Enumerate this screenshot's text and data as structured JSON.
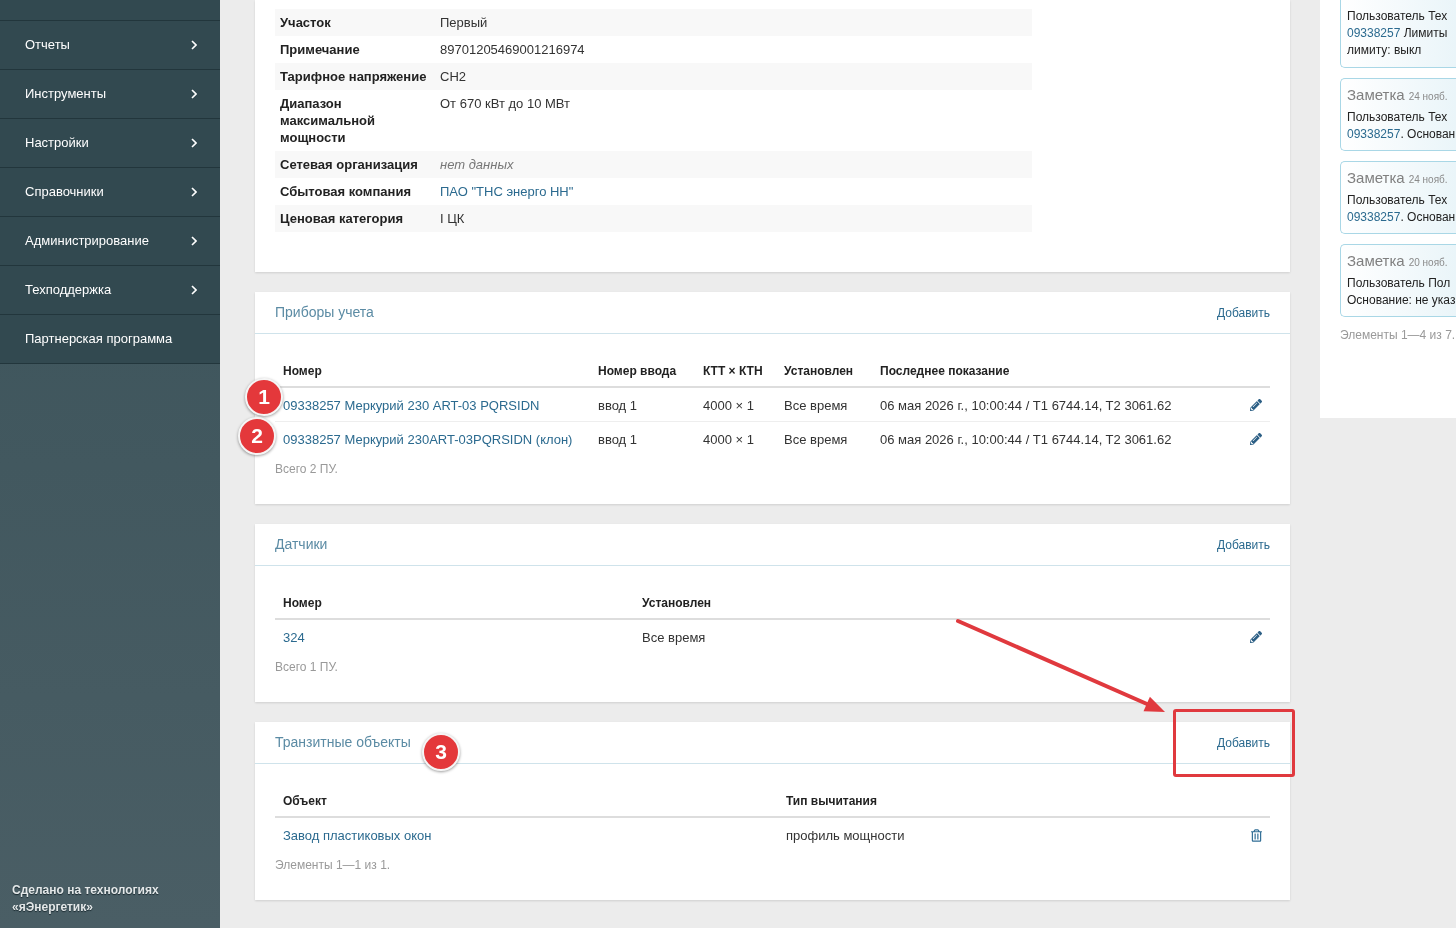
{
  "sidebar": {
    "items": [
      {
        "label": "Отчеты",
        "kind": "submenu"
      },
      {
        "label": "Инструменты",
        "kind": "submenu"
      },
      {
        "label": "Настройки",
        "kind": "submenu"
      },
      {
        "label": "Справочники",
        "kind": "submenu"
      },
      {
        "label": "Администрирование",
        "kind": "submenu"
      },
      {
        "label": "Техподдержка",
        "kind": "submenu"
      },
      {
        "label": "Партнерская программа",
        "kind": "link"
      }
    ],
    "footer": "Сделано на технологиях «яЭнергетик»"
  },
  "details": {
    "rows": [
      {
        "label": "Участок",
        "value": "Первый",
        "kind": "text"
      },
      {
        "label": "Примечание",
        "value": "89701205469001216974",
        "kind": "text"
      },
      {
        "label": "Тарифное напряжение",
        "value": "СН2",
        "kind": "text"
      },
      {
        "label": "Диапазон максимальной мощности",
        "value": "От 670 кВт до 10 МВт",
        "kind": "text"
      },
      {
        "label": "Сетевая организация",
        "value": "нет данных",
        "kind": "muted"
      },
      {
        "label": "Сбытовая компания",
        "value": "ПАО \"ТНС энерго НН\"",
        "kind": "link"
      },
      {
        "label": "Ценовая категория",
        "value": "I ЦК",
        "kind": "text"
      }
    ]
  },
  "meters": {
    "title": "Приборы учета",
    "add": "Добавить",
    "columns": [
      "Номер",
      "Номер ввода",
      "КТТ × КТН",
      "Установлен",
      "Последнее показание"
    ],
    "rows": [
      {
        "cells": [
          "09338257 Меркурий 230 ART-03 PQRSIDN",
          "ввод 1",
          "4000 × 1",
          "Все время",
          "06 мая 2026 г., 10:00:44 / T1 6744.14, T2 3061.62"
        ],
        "kind": "editable"
      },
      {
        "cells": [
          "09338257 Меркурий 230ART-03PQRSIDN (клон)",
          "ввод 1",
          "4000 × 1",
          "Все время",
          "06 мая 2026 г., 10:00:44 / T1 6744.14, T2 3061.62"
        ],
        "kind": "editable"
      }
    ],
    "footer": "Всего 2 ПУ."
  },
  "sensors": {
    "title": "Датчики",
    "add": "Добавить",
    "columns": [
      "Номер",
      "Установлен"
    ],
    "rows": [
      {
        "cells": [
          "324",
          "Все время"
        ],
        "kind": "editable"
      }
    ],
    "footer": "Всего 1 ПУ."
  },
  "transit": {
    "title": "Транзитные объекты",
    "add": "Добавить",
    "columns": [
      "Объект",
      "Тип вычитания"
    ],
    "rows": [
      {
        "cells": [
          "Завод пластиковых окон",
          "профиль мощности"
        ],
        "kind": "deletable"
      }
    ],
    "footer": "Элементы 1—1 из 1."
  },
  "notes": {
    "items": [
      {
        "lines": [
          {
            "text": "Пользователь Тех"
          },
          {
            "link": "09338257",
            "text": " Лимиты"
          },
          {
            "text": "лимиту: выкл"
          }
        ]
      },
      {
        "title": "Заметка",
        "date": "24 нояб.",
        "lines": [
          {
            "text": "Пользователь Тех"
          },
          {
            "link": "09338257",
            "text": ". Основан"
          }
        ]
      },
      {
        "title": "Заметка",
        "date": "24 нояб.",
        "lines": [
          {
            "text": "Пользователь Тех"
          },
          {
            "link": "09338257",
            "text": ". Основан"
          }
        ]
      },
      {
        "title": "Заметка",
        "date": "20 нояб.",
        "lines": [
          {
            "text": "Пользователь Пол"
          },
          {
            "text": "Основание: не указ"
          }
        ]
      }
    ],
    "footer": "Элементы 1—4 из 7."
  },
  "annotations": {
    "markers": [
      {
        "label": "1"
      },
      {
        "label": "2"
      },
      {
        "label": "3"
      }
    ]
  }
}
